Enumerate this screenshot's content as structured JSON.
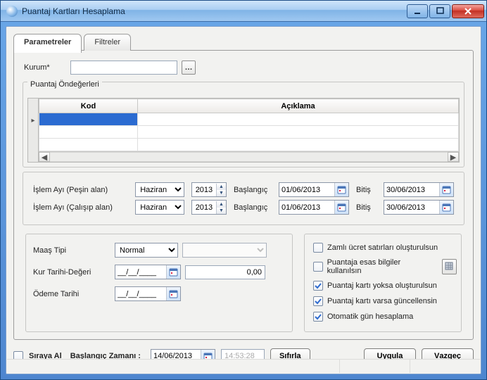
{
  "window": {
    "title": "Puantaj Kartları Hesaplama"
  },
  "tabs": {
    "parametreler": "Parametreler",
    "filtreler": "Filtreler"
  },
  "kurum": {
    "label": "Kurum*",
    "value": ""
  },
  "defaults_group": {
    "legend": "Puantaj Öndeğerleri",
    "col_kod": "Kod",
    "col_aciklama": "Açıklama"
  },
  "period": {
    "row1_label": "İşlem Ayı (Peşin alan)",
    "row2_label": "İşlem Ayı (Çalışıp alan)",
    "month_value": "Haziran",
    "year_value": "2013",
    "start_label": "Başlangıç",
    "end_label": "Bitiş",
    "start_date": "01/06/2013",
    "end_date": "30/06/2013"
  },
  "left_group": {
    "maas_tipi_label": "Maaş Tipi",
    "maas_tipi_value": "Normal",
    "kur_label": "Kur Tarihi-Değeri",
    "kur_date": "__/__/____",
    "kur_value": "0,00",
    "odeme_label": "Ödeme Tarihi",
    "odeme_date": "__/__/____"
  },
  "right_group": {
    "opt1": "Zamlı ücret satırları oluşturulsun",
    "opt2": "Puantaja esas bilgiler kullanılsın",
    "opt3": "Puantaj kartı yoksa oluşturulsun",
    "opt4": "Puantaj kartı varsa güncellensin",
    "opt5": "Otomatik gün hesaplama",
    "checked": {
      "opt1": false,
      "opt2": false,
      "opt3": true,
      "opt4": true,
      "opt5": true
    }
  },
  "bottom": {
    "siraya_al": "Sıraya Al",
    "baslangic_zamani": "Başlangıç Zamanı :",
    "date": "14/06/2013",
    "time": "14:53:28",
    "sifirla": "Sıfırla",
    "uygula_letter": "U",
    "uygula_rest": "ygula",
    "vazgec_letter": "V",
    "vazgec_rest": "azgeç"
  }
}
